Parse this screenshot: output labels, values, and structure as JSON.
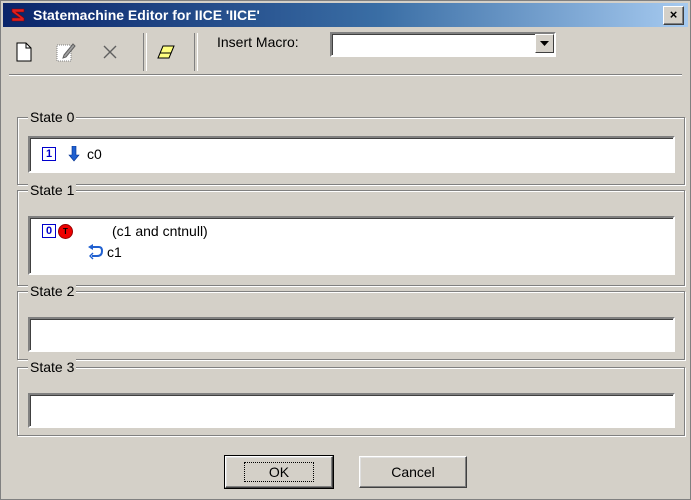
{
  "window": {
    "title": "Statemachine Editor for IICE 'IICE'",
    "close_label": "×"
  },
  "toolbar": {
    "macro_label": "Insert Macro:",
    "macro_value": "",
    "buttons": [
      "new-document-icon",
      "edit-icon",
      "delete-icon",
      "eraser-icon"
    ]
  },
  "states": [
    {
      "title": "State 0",
      "lines": [
        {
          "marker": "1",
          "icon": "arrow-down-icon",
          "text": "c0"
        }
      ]
    },
    {
      "title": "State 1",
      "lines": [
        {
          "marker": "0",
          "icon": "transition-t-icon",
          "text": "(c1 and cntnull)"
        },
        {
          "icon": "loop-back-icon",
          "text": "c1"
        }
      ]
    },
    {
      "title": "State 2",
      "lines": []
    },
    {
      "title": "State 3",
      "lines": []
    }
  ],
  "buttons": {
    "ok": "OK",
    "cancel": "Cancel"
  },
  "colors": {
    "title_bar_start": "#0a246a",
    "title_bar_end": "#a6caf0",
    "face": "#d4d0c8",
    "marker_blue": "#0000cc",
    "transition_red": "#e00000"
  }
}
